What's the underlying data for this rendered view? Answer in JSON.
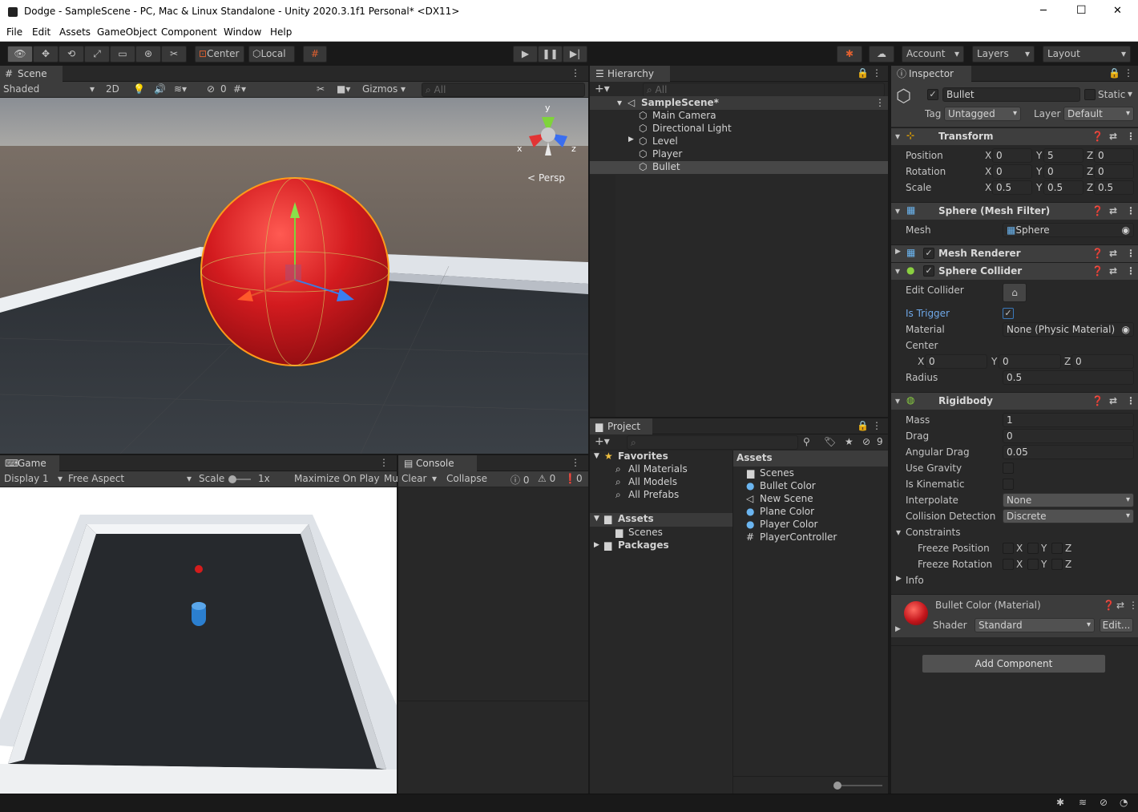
{
  "window": {
    "title": "Dodge - SampleScene - PC, Mac & Linux Standalone - Unity 2020.3.1f1 Personal* <DX11>",
    "min": "─",
    "max": "☐",
    "close": "✕"
  },
  "menu": [
    "File",
    "Edit",
    "Assets",
    "GameObject",
    "Component",
    "Window",
    "Help"
  ],
  "toolbar": {
    "pivot": "Center",
    "space": "Local",
    "account": "Account",
    "layers": "Layers",
    "layout": "Layout"
  },
  "scene": {
    "tab": "Scene",
    "shading": "Shaded",
    "mode2d": "2D",
    "hidden_count": "0",
    "gizmos": "Gizmos",
    "search_placeholder": "All",
    "persp": "Persp",
    "axis_x": "x",
    "axis_y": "y",
    "axis_z": "z"
  },
  "game": {
    "tab": "Game",
    "display": "Display 1",
    "aspect": "Free Aspect",
    "scale_label": "Scale",
    "scale_value": "1x",
    "maximize": "Maximize On Play",
    "mute": "Mu"
  },
  "console": {
    "tab": "Console",
    "clear": "Clear",
    "collapse": "Collapse",
    "logs": "0",
    "warnings": "0",
    "errors": "0"
  },
  "hierarchy": {
    "tab": "Hierarchy",
    "search_placeholder": "All",
    "scene": "SampleScene*",
    "items": [
      "Main Camera",
      "Directional Light",
      "Level",
      "Player",
      "Bullet"
    ]
  },
  "project": {
    "tab": "Project",
    "hidden_count": "9",
    "favorites": "Favorites",
    "fav_items": [
      "All Materials",
      "All Models",
      "All Prefabs"
    ],
    "assets_root": "Assets",
    "assets_children": [
      "Scenes"
    ],
    "packages": "Packages",
    "assets_header": "Assets",
    "asset_items": [
      "Scenes",
      "Bullet Color",
      "New Scene",
      "Plane Color",
      "Player Color",
      "PlayerController"
    ]
  },
  "inspector": {
    "tab": "Inspector",
    "object_name": "Bullet",
    "static": "Static",
    "tag_label": "Tag",
    "tag": "Untagged",
    "layer_label": "Layer",
    "layer": "Default",
    "transform": {
      "title": "Transform",
      "position": {
        "label": "Position",
        "x": "0",
        "y": "5",
        "z": "0"
      },
      "rotation": {
        "label": "Rotation",
        "x": "0",
        "y": "0",
        "z": "0"
      },
      "scale": {
        "label": "Scale",
        "x": "0.5",
        "y": "0.5",
        "z": "0.5"
      }
    },
    "mesh_filter": {
      "title": "Sphere (Mesh Filter)",
      "mesh_label": "Mesh",
      "mesh": "Sphere"
    },
    "mesh_renderer": {
      "title": "Mesh Renderer"
    },
    "sphere_collider": {
      "title": "Sphere Collider",
      "edit_collider": "Edit Collider",
      "is_trigger": "Is Trigger",
      "material_label": "Material",
      "material": "None (Physic Material)",
      "center_label": "Center",
      "cx": "0",
      "cy": "0",
      "cz": "0",
      "radius_label": "Radius",
      "radius": "0.5"
    },
    "rigidbody": {
      "title": "Rigidbody",
      "mass_label": "Mass",
      "mass": "1",
      "drag_label": "Drag",
      "drag": "0",
      "angular_drag_label": "Angular Drag",
      "angular_drag": "0.05",
      "use_gravity": "Use Gravity",
      "is_kinematic": "Is Kinematic",
      "interpolate_label": "Interpolate",
      "interpolate": "None",
      "collision_label": "Collision Detection",
      "collision": "Discrete",
      "constraints": "Constraints",
      "freeze_position": "Freeze Position",
      "freeze_rotation": "Freeze Rotation",
      "info": "Info"
    },
    "material": {
      "title": "Bullet Color (Material)",
      "shader_label": "Shader",
      "shader": "Standard",
      "edit": "Edit..."
    },
    "add_component": "Add Component"
  },
  "colors": {
    "accent": "#3a79bb",
    "bg": "#282828",
    "header": "#3c3c3c",
    "bullet": "#c4161c"
  }
}
